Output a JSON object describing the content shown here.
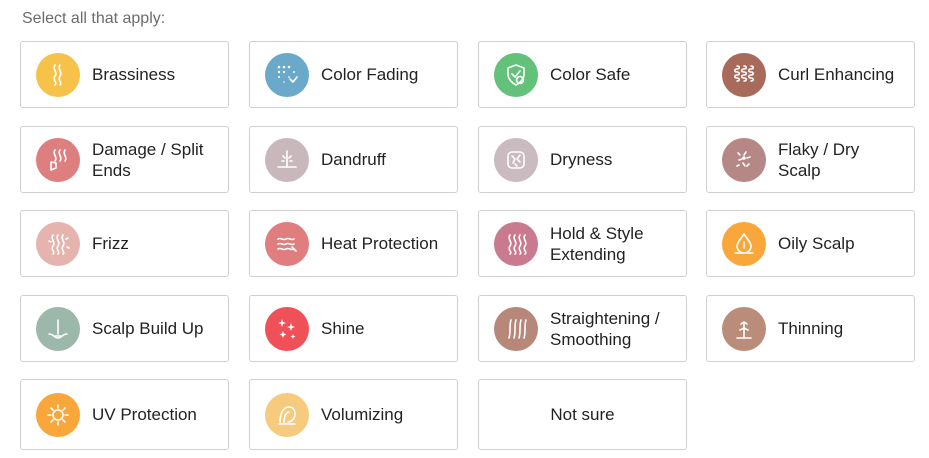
{
  "prompt": "Select all that apply:",
  "options": [
    {
      "label": "Brassiness",
      "icon": "hair-strand-icon",
      "color": "#F6C24A"
    },
    {
      "label": "Color Fading",
      "icon": "fading-dots-icon",
      "color": "#6AA9C9"
    },
    {
      "label": "Color Safe",
      "icon": "shield-icon",
      "color": "#63C17A"
    },
    {
      "label": "Curl Enhancing",
      "icon": "curls-icon",
      "color": "#A86A5A"
    },
    {
      "label": "Damage / Split Ends",
      "icon": "split-ends-icon",
      "color": "#DE7F7F"
    },
    {
      "label": "Dandruff",
      "icon": "dandruff-icon",
      "color": "#C8B8BC"
    },
    {
      "label": "Dryness",
      "icon": "dry-skin-icon",
      "color": "#CABBC0"
    },
    {
      "label": "Flaky / Dry Scalp",
      "icon": "flakes-icon",
      "color": "#B58886"
    },
    {
      "label": "Frizz",
      "icon": "frizz-icon",
      "color": "#E6B4AE"
    },
    {
      "label": "Heat Protection",
      "icon": "heat-waves-icon",
      "color": "#E07D7F"
    },
    {
      "label": "Hold & Style Extending",
      "icon": "hold-waves-icon",
      "color": "#C97A8E"
    },
    {
      "label": "Oily Scalp",
      "icon": "oil-drop-icon",
      "color": "#F9A63A"
    },
    {
      "label": "Scalp Build Up",
      "icon": "buildup-icon",
      "color": "#9BB8AB"
    },
    {
      "label": "Shine",
      "icon": "sparkle-icon",
      "color": "#F05158"
    },
    {
      "label": "Straightening / Smoothing",
      "icon": "straight-lines-icon",
      "color": "#B7877A"
    },
    {
      "label": "Thinning",
      "icon": "thinning-icon",
      "color": "#B98D79"
    },
    {
      "label": "UV Protection",
      "icon": "sun-uv-icon",
      "color": "#F9A63A"
    },
    {
      "label": "Volumizing",
      "icon": "volume-icon",
      "color": "#F7CB7E"
    },
    {
      "label": "Not sure",
      "icon": "",
      "color": ""
    }
  ]
}
